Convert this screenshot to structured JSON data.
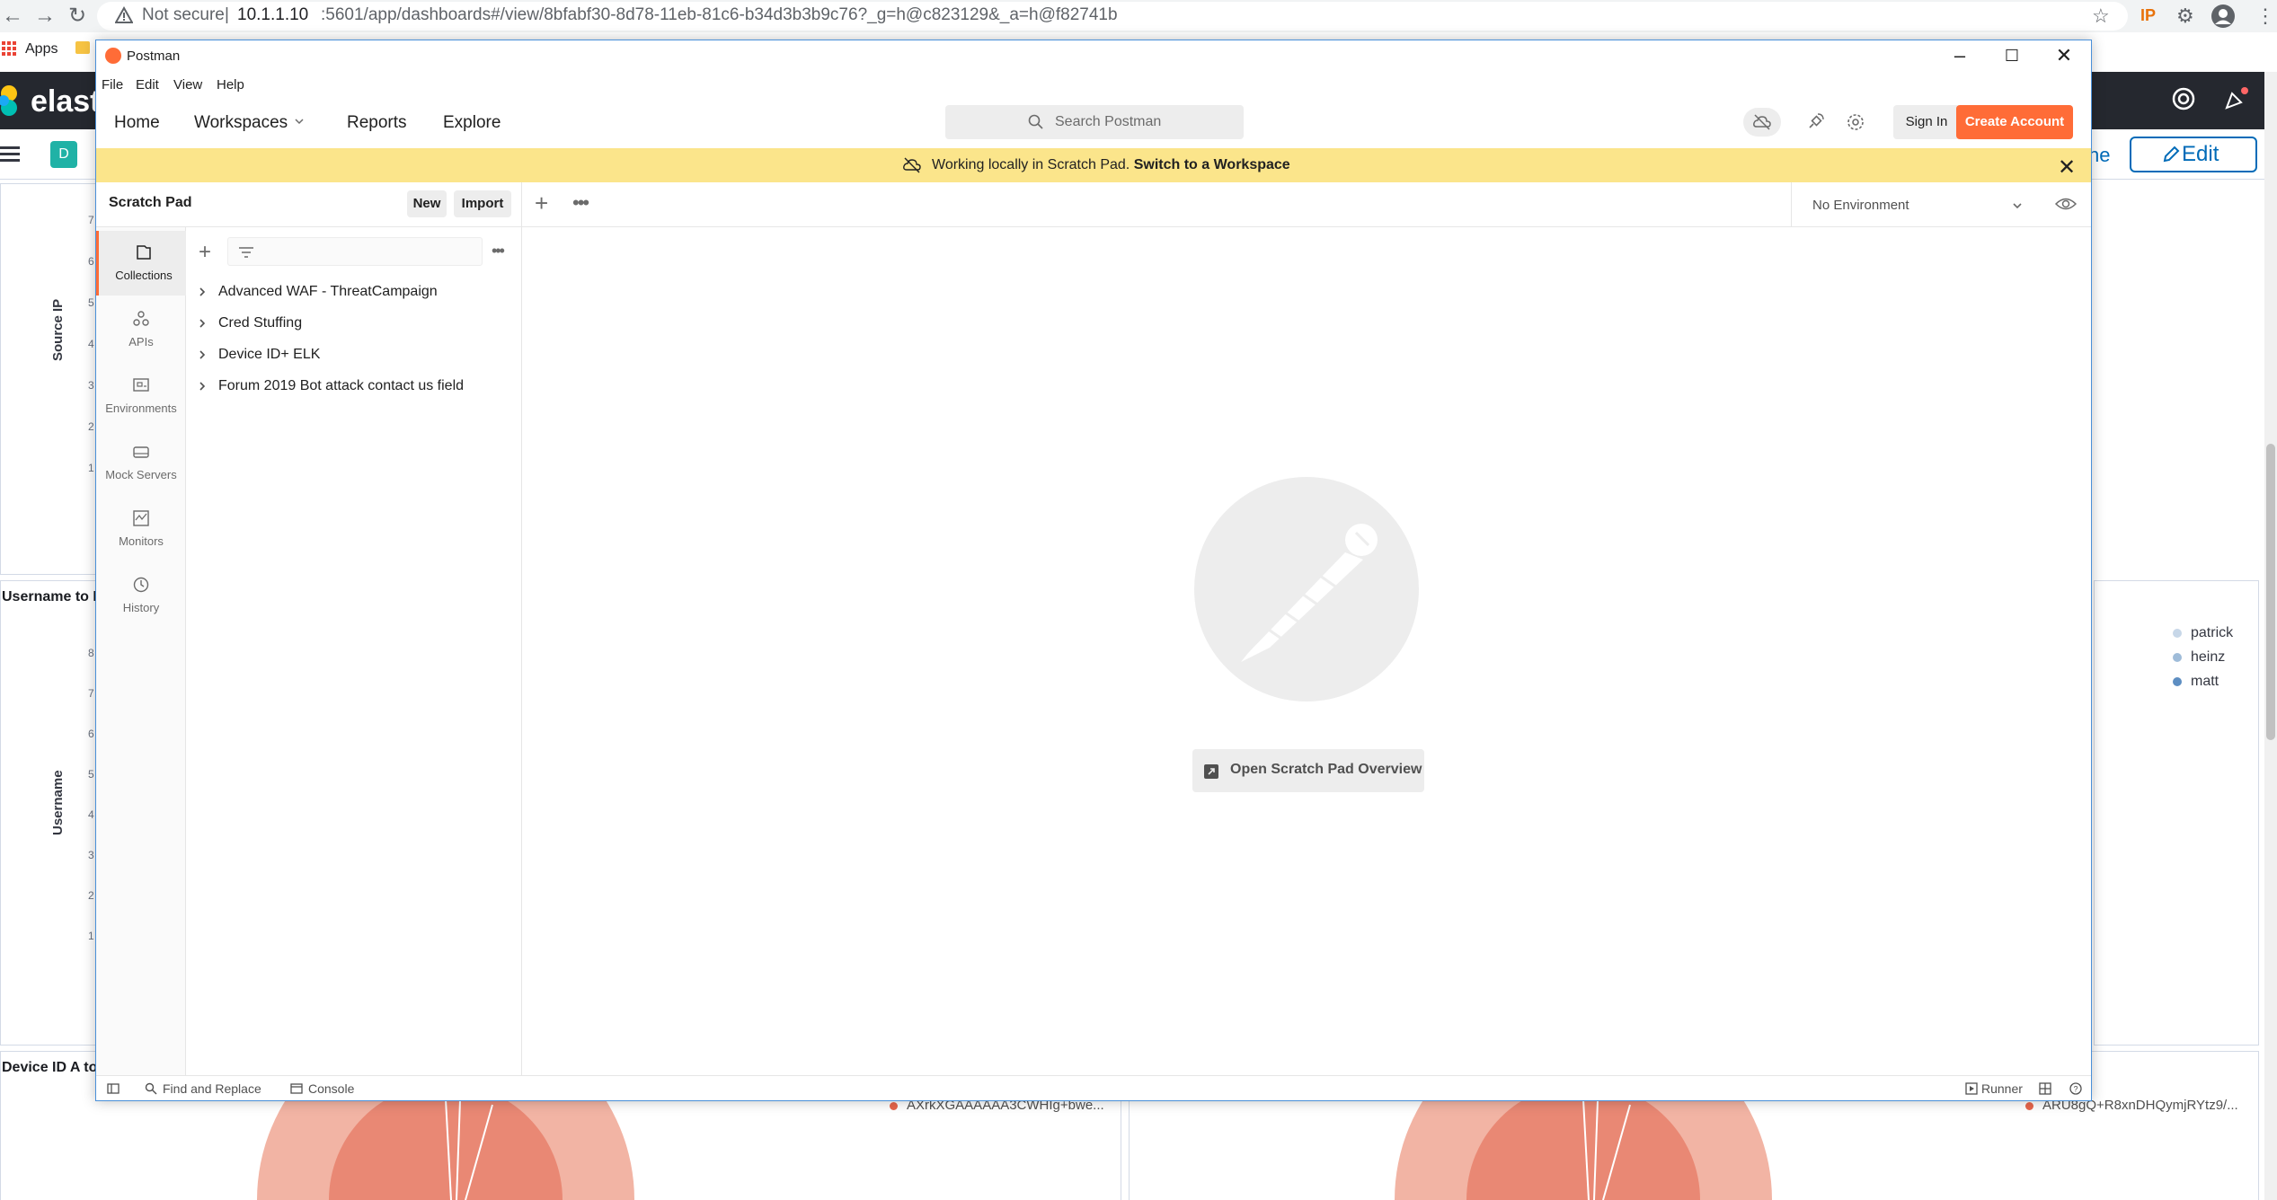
{
  "browser": {
    "not_secure": "Not secure",
    "separator": "|",
    "url_host": "10.1.1.10",
    "url_rest": ":5601/app/dashboards#/view/8bfabf30-8d78-11eb-81c6-b34d3b3b9c76?_g=h@c823129&_a=h@f82741b",
    "apps_label": "Apps",
    "ext_ip": "IP"
  },
  "kibana": {
    "brand": "elasti",
    "d_badge": "D",
    "partial_link": "ne",
    "edit_label": "Edit",
    "panel1_axis": "Source IP",
    "panel1_ticks": [
      "7",
      "6",
      "5",
      "4",
      "3",
      "2",
      "1"
    ],
    "panel2_title": "Username to D",
    "panel2_axis": "Username",
    "panel2_ticks": [
      "8",
      "7",
      "6",
      "5",
      "4",
      "3",
      "2",
      "1"
    ],
    "legend": [
      {
        "label": "patrick",
        "color": "#c7d7e8"
      },
      {
        "label": "heinz",
        "color": "#9fbcd9"
      },
      {
        "label": "matt",
        "color": "#5d8ec2"
      }
    ],
    "panel3_title": "Device ID A to",
    "legend_a": "AXrkXGAAAAAA3CWHIg+bwe...",
    "legend_b": "ARU8gQ+R8xnDHQymjRYtz9/...",
    "accent_color": "#006bb8"
  },
  "postman": {
    "window_title": "Postman",
    "menu": [
      "File",
      "Edit",
      "View",
      "Help"
    ],
    "nav": [
      "Home",
      "Workspaces",
      "Reports",
      "Explore"
    ],
    "search_placeholder": "Search Postman",
    "sign_in": "Sign In",
    "create_account": "Create Account",
    "brand_color": "#ff6c37",
    "banner": {
      "text": "Working locally in Scratch Pad.",
      "link": "Switch to a Workspace",
      "color": "#fbe58b"
    },
    "scratch_pad": "Scratch Pad",
    "btn_new": "New",
    "btn_import": "Import",
    "environment": "No Environment",
    "rail": [
      {
        "label": "Collections",
        "icon": "collections-icon"
      },
      {
        "label": "APIs",
        "icon": "apis-icon"
      },
      {
        "label": "Environments",
        "icon": "environments-icon"
      },
      {
        "label": "Mock Servers",
        "icon": "mock-servers-icon"
      },
      {
        "label": "Monitors",
        "icon": "monitors-icon"
      },
      {
        "label": "History",
        "icon": "history-icon"
      }
    ],
    "collections": [
      "Advanced WAF - ThreatCampaign",
      "Cred Stuffing",
      "Device ID+ ELK",
      "Forum 2019 Bot attack contact us field"
    ],
    "overview_button": "Open Scratch Pad Overview",
    "status": {
      "find_replace": "Find and Replace",
      "console": "Console",
      "runner": "Runner"
    }
  }
}
